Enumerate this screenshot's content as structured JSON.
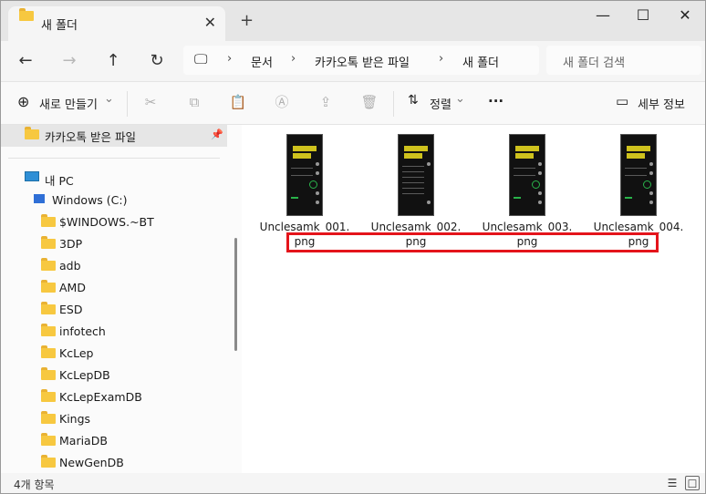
{
  "window": {
    "tab_title": "새 폴더",
    "tab_close": "✕",
    "new_tab": "+",
    "minimize": "—",
    "maximize": "☐",
    "close": "✕"
  },
  "address": {
    "back": "←",
    "forward": "→",
    "up": "↑",
    "refresh": "↻",
    "pc_icon": "🖵",
    "sep": "›",
    "crumbs": [
      "문서",
      "카카오톡 받은 파일",
      "새 폴더"
    ],
    "search_placeholder": "새 폴더 검색"
  },
  "toolbar": {
    "new_label": "새로 만들기",
    "new_icon": "⊕",
    "dropdown": "⌄",
    "cut_icon": "✂",
    "copy_icon": "⧉",
    "paste_icon": "📋",
    "rename_icon": "Ⓐ",
    "share_icon": "⇪",
    "delete_icon": "🗑",
    "sort_icon": "⇅",
    "sort_label": "정렬",
    "more_label": "···",
    "details_icon": "▭",
    "details_label": "세부 정보"
  },
  "sidebar": {
    "quick_item": "카카오톡 받은 파일",
    "pin_icon": "📌",
    "pc_label": "내 PC",
    "drive_label": "Windows (C:)",
    "folders": [
      "$WINDOWS.~BT",
      "3DP",
      "adb",
      "AMD",
      "ESD",
      "infotech",
      "KcLep",
      "KcLepDB",
      "KcLepExamDB",
      "Kings",
      "MariaDB",
      "NewGenDB"
    ]
  },
  "files": [
    {
      "name_line1": "Unclesamk_001.",
      "name_line2": "png"
    },
    {
      "name_line1": "Unclesamk_002.",
      "name_line2": "png"
    },
    {
      "name_line1": "Unclesamk_003.",
      "name_line2": "png"
    },
    {
      "name_line1": "Unclesamk_004.",
      "name_line2": "png"
    }
  ],
  "status": {
    "count_text": "4개 항목",
    "details_view_icon": "☰",
    "tiles_view_icon": "☐"
  },
  "colors": {
    "highlight": "#e4141b",
    "folder": "#f7c840",
    "thumbnail_accent": "#cfc21d"
  }
}
